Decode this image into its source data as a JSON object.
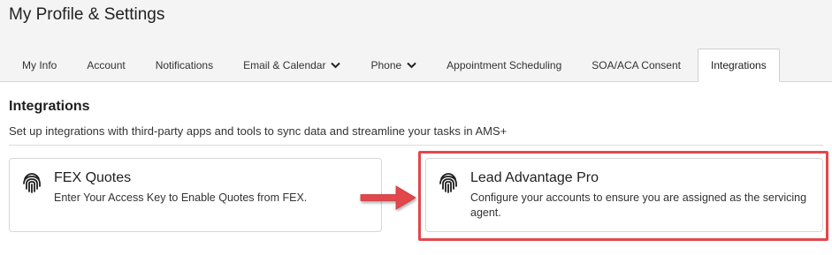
{
  "page": {
    "title": "My Profile & Settings"
  },
  "tabs": [
    {
      "label": "My Info",
      "dropdown": false,
      "active": false
    },
    {
      "label": "Account",
      "dropdown": false,
      "active": false
    },
    {
      "label": "Notifications",
      "dropdown": false,
      "active": false
    },
    {
      "label": "Email & Calendar",
      "dropdown": true,
      "active": false
    },
    {
      "label": "Phone",
      "dropdown": true,
      "active": false
    },
    {
      "label": "Appointment Scheduling",
      "dropdown": false,
      "active": false
    },
    {
      "label": "SOA/ACA Consent",
      "dropdown": false,
      "active": false
    },
    {
      "label": "Integrations",
      "dropdown": false,
      "active": true
    }
  ],
  "section": {
    "title": "Integrations",
    "description": "Set up integrations with third-party apps and tools to sync data and streamline your tasks in AMS+"
  },
  "cards": [
    {
      "title": "FEX Quotes",
      "description": "Enter Your Access Key to Enable Quotes from FEX.",
      "icon": "fingerprint-icon"
    },
    {
      "title": "Lead Advantage Pro",
      "description": "Configure your accounts to ensure you are assigned as the servicing agent.",
      "icon": "fingerprint-icon"
    }
  ],
  "colors": {
    "highlight": "#e2474b",
    "arrow": "#e2474b",
    "header_bg": "#f4f4f4"
  }
}
